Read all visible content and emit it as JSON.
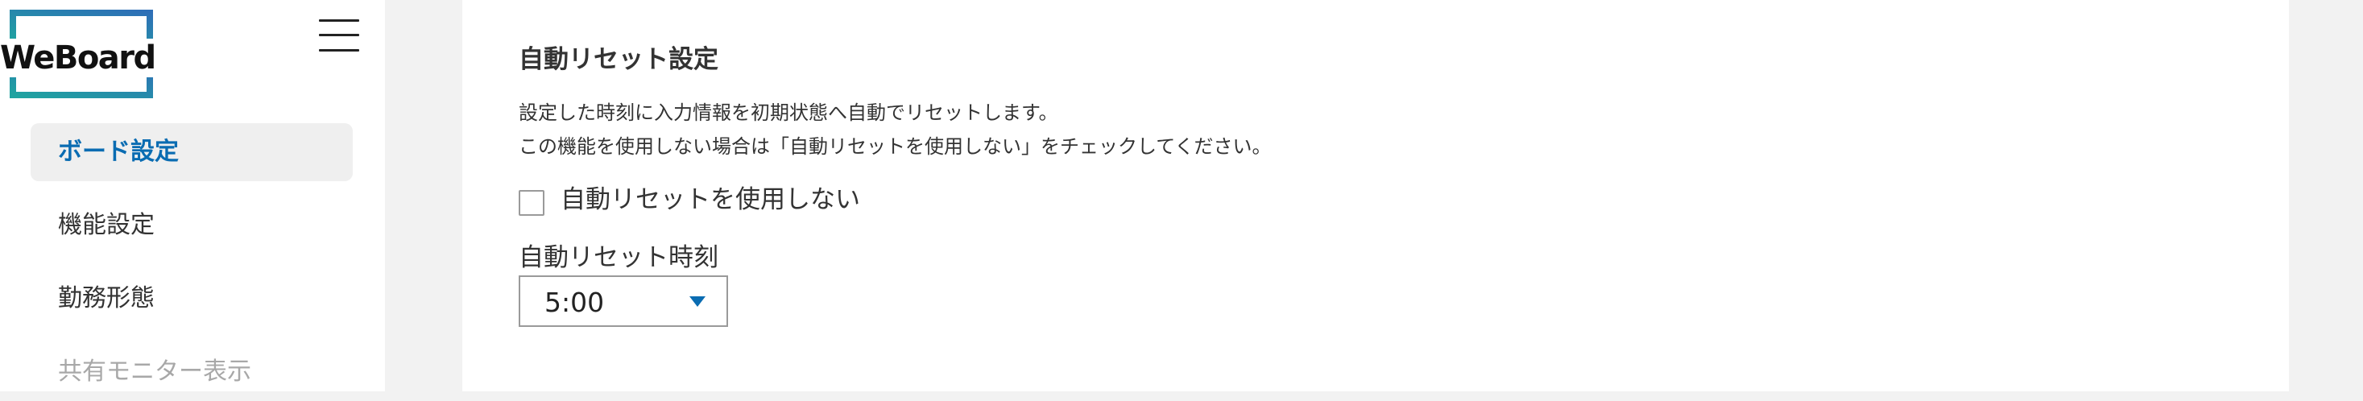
{
  "app": {
    "logo_text": "WeBoard"
  },
  "colors": {
    "accent": "#0a6cb2",
    "logo_gradient": [
      "#1fa3a0",
      "#2e6fb7"
    ]
  },
  "sidebar": {
    "menu_icon": "hamburger-menu-icon",
    "items": [
      {
        "label": "ボード設定",
        "active": true
      },
      {
        "label": "機能設定"
      },
      {
        "label": "勤務形態"
      },
      {
        "label": "共有モニター表示",
        "muted": true
      }
    ]
  },
  "main": {
    "section_title": "自動リセット設定",
    "description": [
      "設定した時刻に入力情報を初期状態へ自動でリセットします。",
      "この機能を使用しない場合は「自動リセットを使用しない」をチェックしてください。"
    ],
    "disable_checkbox": {
      "label": "自動リセットを使用しない",
      "checked": false
    },
    "reset_time": {
      "label": "自動リセット時刻",
      "value": "5:00",
      "icon": "caret-down-icon"
    }
  }
}
